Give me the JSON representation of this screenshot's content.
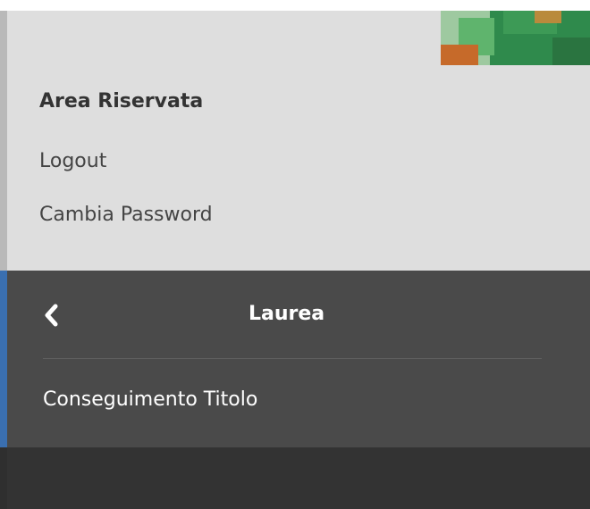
{
  "user": {
    "avatar_icon": "user-avatar-thumbnail"
  },
  "reserved_area": {
    "title": "Area Riservata",
    "links": [
      {
        "label": "Logout"
      },
      {
        "label": "Cambia Password"
      }
    ]
  },
  "submenu": {
    "back_icon": "chevron-left-icon",
    "title": "Laurea",
    "items": [
      {
        "label": "Conseguimento Titolo"
      }
    ]
  },
  "colors": {
    "top_panel_bg": "#dedede",
    "dark_panel_bg": "#4a4a4a",
    "bottom_panel_bg": "#333333",
    "accent_left_bar": "#3a6fb0"
  }
}
